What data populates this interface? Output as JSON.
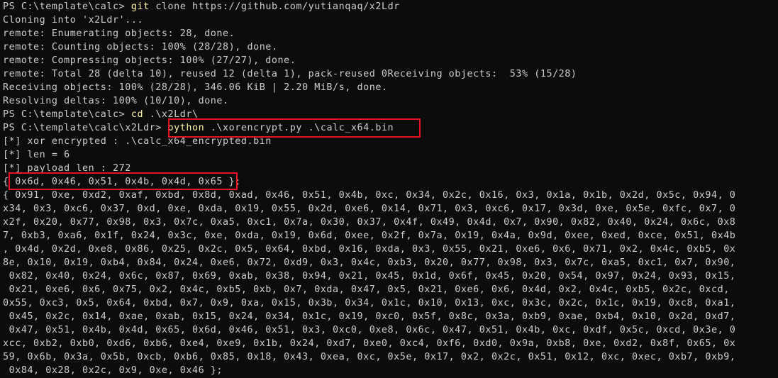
{
  "terminal": {
    "lines": [
      {
        "prompt": "PS C:\\template\\calc> ",
        "cmd": "git",
        "rest": " clone https://github.com/yutianqaq/x2Ldr"
      },
      {
        "text": "Cloning into 'x2Ldr'..."
      },
      {
        "text": "remote: Enumerating objects: 28, done."
      },
      {
        "text": "remote: Counting objects: 100% (28/28), done."
      },
      {
        "text": "remote: Compressing objects: 100% (27/27), done."
      },
      {
        "text": "remote: Total 28 (delta 10), reused 12 (delta 1), pack-reused 0Receiving objects:  53% (15/28)"
      },
      {
        "text": "Receiving objects: 100% (28/28), 346.06 KiB | 2.20 MiB/s, done."
      },
      {
        "text": "Resolving deltas: 100% (10/10), done."
      },
      {
        "prompt": "PS C:\\template\\calc> ",
        "cmd": "cd",
        "rest": " .\\x2Ldr\\"
      },
      {
        "prompt": "PS C:\\template\\calc\\x2Ldr> ",
        "cmd": "python",
        "rest": " .\\xorencrypt.py .\\calc_x64.bin"
      },
      {
        "text": "[*] xor encrypted : .\\calc_x64_encrypted.bin"
      },
      {
        "text": "[*] len = 6"
      },
      {
        "text": "[*] payload len : 272"
      },
      {
        "text": "{ 0x6d, 0x46, 0x51, 0x4b, 0x4d, 0x65 };"
      },
      {
        "text": "{ 0x91, 0xe, 0xd2, 0xaf, 0xbd, 0x8d, 0xad, 0x46, 0x51, 0x4b, 0xc, 0x34, 0x2c, 0x16, 0x3, 0x1a, 0x1b, 0x2d, 0x5c, 0x94, 0"
      },
      {
        "text": "x34, 0x3, 0xc6, 0x37, 0xd, 0xe, 0xda, 0x19, 0x55, 0x2d, 0xe6, 0x14, 0x71, 0x3, 0xc6, 0x17, 0x3d, 0xe, 0x5e, 0xfc, 0x7, 0"
      },
      {
        "text": "x2f, 0x20, 0x77, 0x98, 0x3, 0x7c, 0xa5, 0xc1, 0x7a, 0x30, 0x37, 0x4f, 0x49, 0x4d, 0x7, 0x90, 0x82, 0x40, 0x24, 0x6c, 0x8"
      },
      {
        "text": "7, 0xb3, 0xa6, 0x1f, 0x24, 0x3c, 0xe, 0xda, 0x19, 0x6d, 0xee, 0x2f, 0x7a, 0x19, 0x4a, 0x9d, 0xee, 0xed, 0xce, 0x51, 0x4b"
      },
      {
        "text": ", 0x4d, 0x2d, 0xe8, 0x86, 0x25, 0x2c, 0x5, 0x64, 0xbd, 0x16, 0xda, 0x3, 0x55, 0x21, 0xe6, 0x6, 0x71, 0x2, 0x4c, 0xb5, 0x"
      },
      {
        "text": "8e, 0x10, 0x19, 0xb4, 0x84, 0x24, 0xe6, 0x72, 0xd9, 0x3, 0x4c, 0xb3, 0x20, 0x77, 0x98, 0x3, 0x7c, 0xa5, 0xc1, 0x7, 0x90,"
      },
      {
        "text": " 0x82, 0x40, 0x24, 0x6c, 0x87, 0x69, 0xab, 0x38, 0x94, 0x21, 0x45, 0x1d, 0x6f, 0x45, 0x20, 0x54, 0x97, 0x24, 0x93, 0x15,"
      },
      {
        "text": " 0x21, 0xe6, 0x6, 0x75, 0x2, 0x4c, 0xb5, 0xb, 0x7, 0xda, 0x47, 0x5, 0x21, 0xe6, 0x6, 0x4d, 0x2, 0x4c, 0xb5, 0x2c, 0xcd,"
      },
      {
        "text": "0x55, 0xc3, 0x5, 0x64, 0xbd, 0x7, 0x9, 0xa, 0x15, 0x3b, 0x34, 0x1c, 0x10, 0x13, 0xc, 0x3c, 0x2c, 0x1c, 0x19, 0xc8, 0xa1,"
      },
      {
        "text": " 0x45, 0x2c, 0x14, 0xae, 0xab, 0x15, 0x24, 0x34, 0x1c, 0x19, 0xc0, 0x5f, 0x8c, 0x3a, 0xb9, 0xae, 0xb4, 0x10, 0x2d, 0xd7,"
      },
      {
        "text": " 0x47, 0x51, 0x4b, 0x4d, 0x65, 0x6d, 0x46, 0x51, 0x3, 0xc0, 0xe8, 0x6c, 0x47, 0x51, 0x4b, 0xc, 0xdf, 0x5c, 0xcd, 0x3e, 0"
      },
      {
        "text": "xcc, 0xb2, 0xb0, 0xd6, 0xb6, 0xe4, 0xe9, 0x1b, 0x24, 0xd7, 0xe0, 0xc4, 0xf6, 0xd0, 0x9a, 0xb8, 0xe, 0xd2, 0x8f, 0x65, 0x"
      },
      {
        "text": "59, 0x6b, 0x3a, 0x5b, 0xcb, 0xb6, 0x85, 0x18, 0x43, 0xea, 0xc, 0x5e, 0x17, 0x2, 0x2c, 0x51, 0x12, 0xc, 0xec, 0xb7, 0xb9,"
      },
      {
        "text": " 0x84, 0x28, 0x2c, 0x9, 0xe, 0x46 };"
      }
    ]
  },
  "colors": {
    "background": "#0c0c0c",
    "text": "#cccccc",
    "command": "#f9f1a5",
    "highlight": "#e81123"
  }
}
